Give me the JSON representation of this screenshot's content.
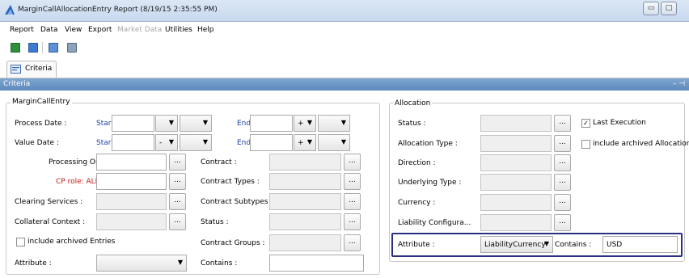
{
  "window": {
    "title": "MarginCallAllocationEntry Report (8/19/15 2:35:55 PM)",
    "controls": [
      "▭",
      "□"
    ]
  },
  "menu": {
    "items": [
      "Report",
      "Data",
      "View",
      "Export",
      "Market Data",
      "Utilities",
      "Help"
    ]
  },
  "tabs": {
    "criteria": "Criteria"
  },
  "panel": {
    "title": "Criteria",
    "controls": "– ⊣"
  },
  "margin_call_entry": {
    "legend": "MarginCallEntry",
    "process_date": {
      "label": "Process Date :",
      "start": "Start",
      "end": "End",
      "start_op": "",
      "end_op": "+"
    },
    "value_date": {
      "label": "Value Date :",
      "start": "Start",
      "end": "End",
      "start_op": "-",
      "end_op": "+"
    },
    "processing_org": "Processing Org",
    "cp_role": "CP role: ALL",
    "clearing_services": "Clearing Services :",
    "collateral_context": "Collateral Context :",
    "include_archived": "include archived Entries",
    "attribute": "Attribute :",
    "contract": "Contract :",
    "contract_types": "Contract Types :",
    "contract_subtypes": "Contract Subtypes :",
    "status": "Status :",
    "contract_groups": "Contract Groups :",
    "contains": "Contains :",
    "ellipsis": "..."
  },
  "allocation": {
    "legend": "Allocation",
    "status": "Status :",
    "allocation_type": "Allocation Type :",
    "direction": "Direction :",
    "underlying_type": "Underlying Type :",
    "currency": "Currency :",
    "liability_config": "Liability Configura...",
    "attribute": "Attribute :",
    "attribute_value": "LiabilityCurrency",
    "contains": "Contains :",
    "contains_value": "USD",
    "last_execution": "Last Execution",
    "last_execution_checked": "✓",
    "include_archived": "include archived Allocations"
  },
  "colors": {
    "highlight_border": "#2b2f83",
    "panel_header": "#5c88bb",
    "start_end_label": "#1c3fa6",
    "cp_role_label": "#c8191a"
  },
  "icons": {
    "app": "app-logo-icon",
    "toolbar": [
      "spreadsheet-export-icon",
      "clear-icon",
      "copy-icon",
      "print-icon"
    ],
    "tab": "criteria-icon"
  }
}
